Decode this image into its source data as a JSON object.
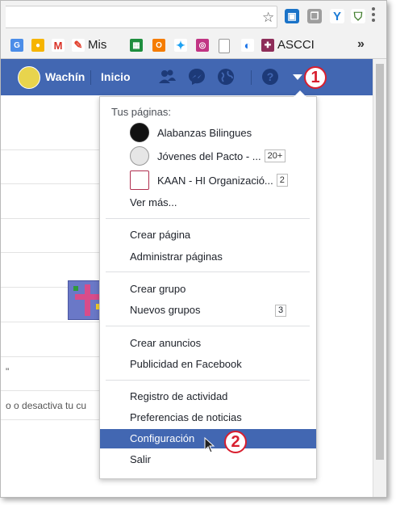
{
  "browser": {
    "bookmarks": {
      "mis_label": "Mis",
      "ascci_label": "ASCCI",
      "more_label": "»"
    }
  },
  "facebook": {
    "user_name": "Wachín",
    "home_label": "Inicio",
    "step1": "1",
    "step2": "2"
  },
  "background": {
    "quote_mark": "\"",
    "cut_text": "o o desactiva tu cu"
  },
  "menu": {
    "pages_header": "Tus páginas:",
    "pages": [
      {
        "name": "Alabanzas Bilingues",
        "count": ""
      },
      {
        "name": "Jóvenes del Pacto - ...",
        "count": "20+"
      },
      {
        "name": "KAAN - HI Organizació...",
        "count": "2"
      }
    ],
    "see_more": "Ver más...",
    "create_page": "Crear página",
    "manage_pages": "Administrar páginas",
    "create_group": "Crear grupo",
    "new_groups": "Nuevos grupos",
    "new_groups_count": "3",
    "create_ads": "Crear anuncios",
    "advertising": "Publicidad en Facebook",
    "activity_log": "Registro de actividad",
    "news_prefs": "Preferencias de noticias",
    "settings": "Configuración",
    "logout": "Salir"
  },
  "colors": {
    "fb_blue": "#4267b2",
    "badge_red": "#d81e2e"
  }
}
